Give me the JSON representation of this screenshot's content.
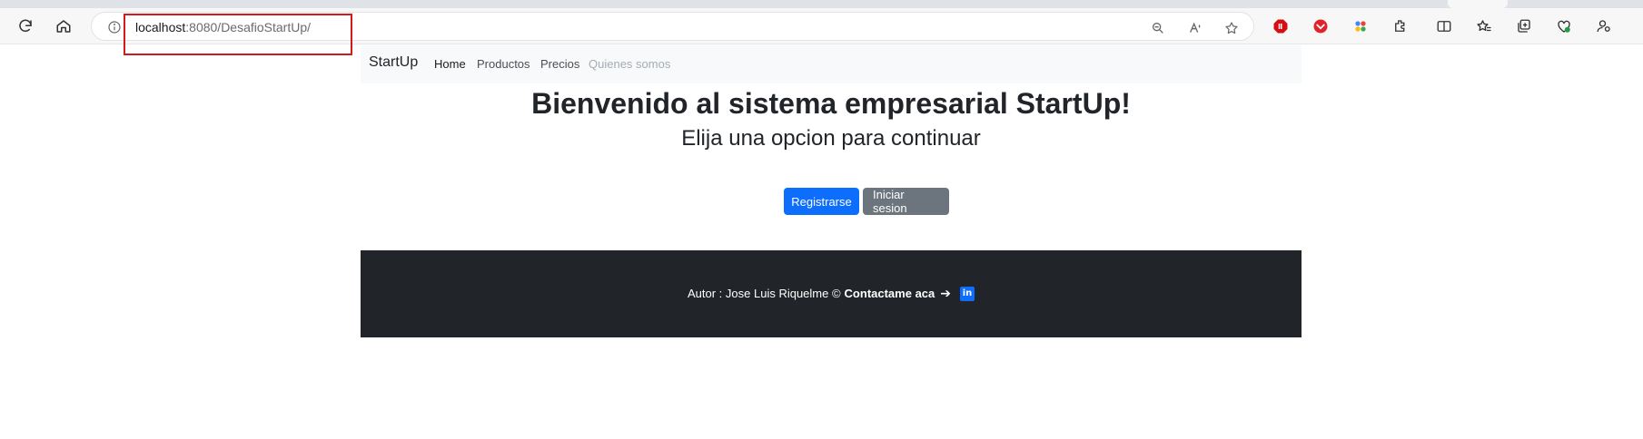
{
  "browser": {
    "url_host": "localhost",
    "url_rest": ":8080/DesafioStartUp/",
    "toolbar_icons": [
      "refresh-icon",
      "home-icon",
      "info-icon",
      "zoom-out-icon",
      "read-aloud-icon",
      "favorite-star-icon",
      "adblock-icon",
      "pocket-icon",
      "extension-colors-icon",
      "extensions-puzzle-icon",
      "split-screen-icon",
      "favorites-icon",
      "collections-icon",
      "browser-essentials-icon",
      "profile-settings-icon"
    ],
    "colors": {
      "highlight": "#d11a1a"
    }
  },
  "navbar": {
    "brand": "StartUp",
    "links": [
      {
        "label": "Home",
        "state": "active"
      },
      {
        "label": "Productos",
        "state": "normal"
      },
      {
        "label": "Precios",
        "state": "normal"
      },
      {
        "label": "Quienes somos",
        "state": "disabled"
      }
    ]
  },
  "hero": {
    "title": "Bienvenido al sistema empresarial StartUp!",
    "subtitle": "Elija una opcion para continuar"
  },
  "actions": {
    "register_label": "Registrarse",
    "login_label": "Iniciar sesion",
    "colors": {
      "primary": "#0d6efd",
      "secondary": "#6c757d"
    }
  },
  "footer": {
    "author_text": "Autor : Jose Luis Riquelme ©",
    "contact_text": "Contactame aca",
    "arrow": "➔",
    "linkedin_glyph": "in",
    "background": "#212529"
  }
}
